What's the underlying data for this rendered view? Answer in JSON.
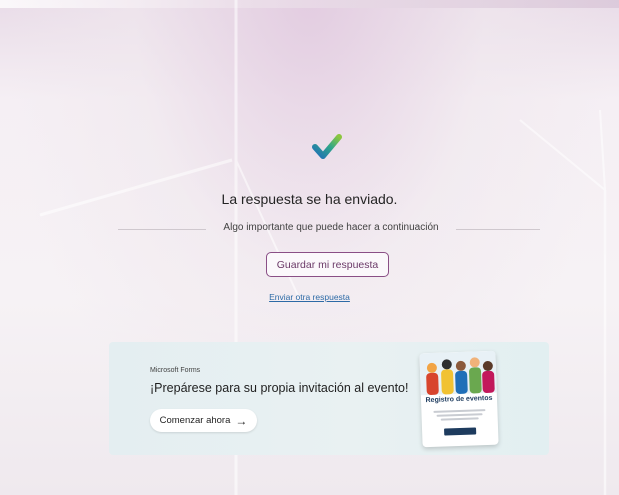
{
  "confirmation": {
    "title": "La respuesta se ha enviado.",
    "subtitle": "Algo importante que puede hacer a continuación",
    "save_label": "Guardar mi respuesta",
    "send_another_label": "Enviar otra respuesta"
  },
  "promo": {
    "brand": "Microsoft Forms",
    "title": "¡Prepárese para su propia invitación al evento!",
    "start_label": "Comenzar ahora",
    "event_card_title": "Registro de eventos"
  },
  "icons": {
    "check": "checkmark-icon",
    "arrow": "arrow-right-icon"
  },
  "colors": {
    "accent": "#8a4f86",
    "link": "#2d6aa6",
    "card_bg": "#e6f0f2"
  }
}
